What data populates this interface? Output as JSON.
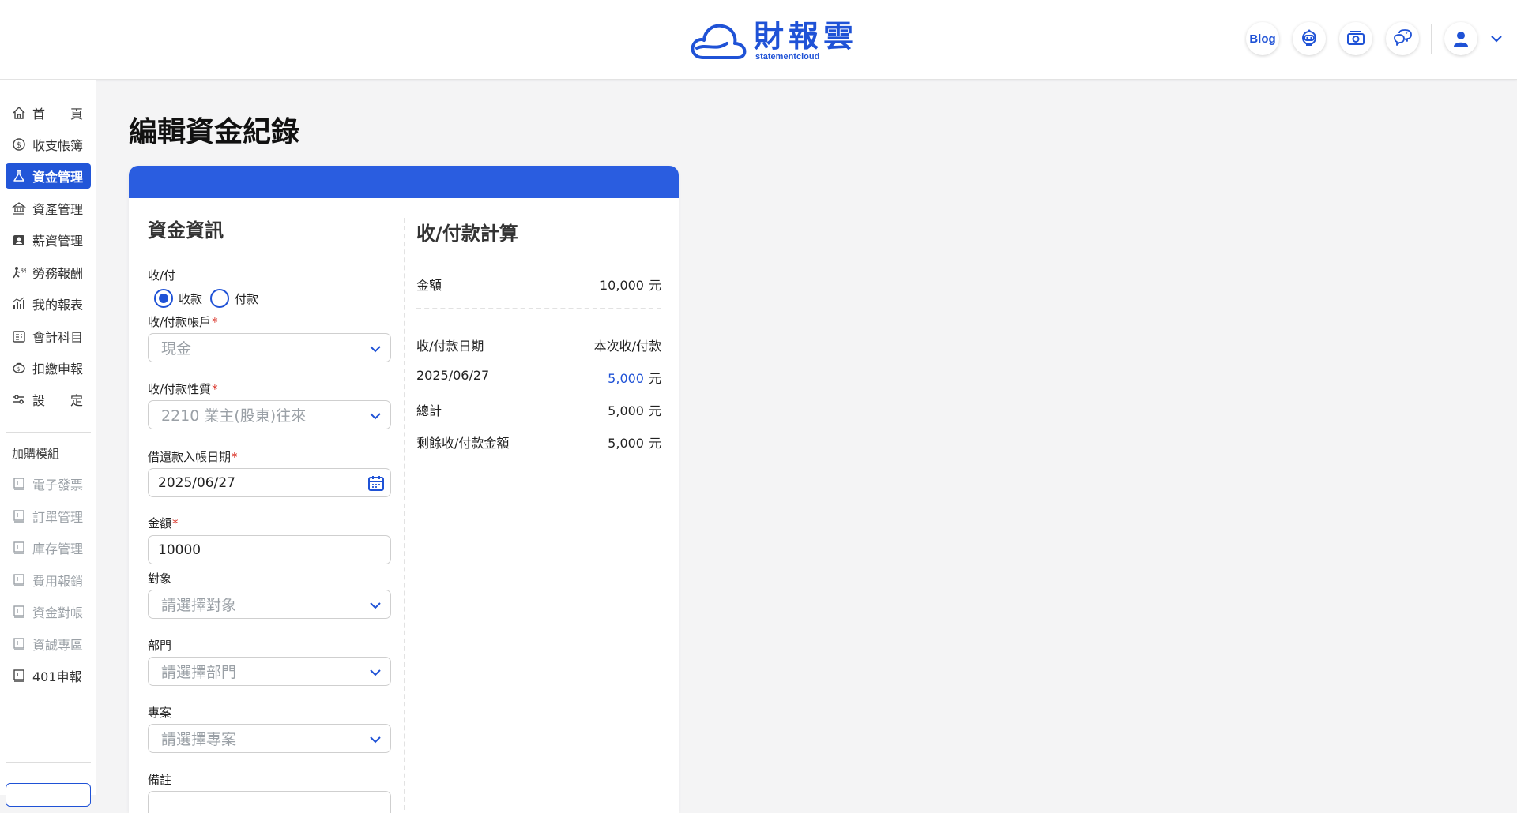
{
  "header": {
    "logo_title": "財報雲",
    "logo_sub": "statementcloud",
    "blog_label": "Blog",
    "icons": [
      "robot-icon",
      "cash-icon",
      "chat-help-icon",
      "user-avatar-icon",
      "chevron-down-icon"
    ]
  },
  "sidebar": {
    "items": [
      {
        "label_a": "首",
        "label_b": "頁",
        "icon": "home-icon"
      },
      {
        "label": "收支帳簿",
        "icon": "coin-icon"
      },
      {
        "label": "資金管理",
        "icon": "flask-icon",
        "active": true
      },
      {
        "label": "資產管理",
        "icon": "asset-icon"
      },
      {
        "label": "薪資管理",
        "icon": "salary-icon"
      },
      {
        "label": "勞務報酬",
        "icon": "labor-icon"
      },
      {
        "label": "我的報表",
        "icon": "report-icon"
      },
      {
        "label": "會計科目",
        "icon": "ledger-icon"
      },
      {
        "label": "扣繳申報",
        "icon": "tax-icon"
      },
      {
        "label_a": "設",
        "label_b": "定",
        "icon": "settings-icon"
      }
    ],
    "addon_group": "加購模組",
    "addons": [
      {
        "label": "電子發票",
        "disabled": true
      },
      {
        "label": "訂單管理",
        "disabled": true
      },
      {
        "label": "庫存管理",
        "disabled": true
      },
      {
        "label": "費用報銷",
        "disabled": true
      },
      {
        "label": "資金對帳",
        "disabled": true
      },
      {
        "label": "資誠專區",
        "disabled": true
      },
      {
        "label": "401申報",
        "disabled": false
      }
    ]
  },
  "page": {
    "title": "編輯資金紀錄"
  },
  "form": {
    "section_title": "資金資訊",
    "type_label": "收/付",
    "type_options": [
      "收款",
      "付款"
    ],
    "type_selected": "收款",
    "account_label": "收/付款帳戶",
    "account_value": "現金",
    "nature_label": "收/付款性質",
    "nature_value": "2210 業主(股東)往來",
    "date_label": "借還款入帳日期",
    "date_value": "2025/06/27",
    "amount_label": "金額",
    "amount_value": "10000",
    "target_label": "對象",
    "target_placeholder": "請選擇對象",
    "dept_label": "部門",
    "dept_placeholder": "請選擇部門",
    "project_label": "專案",
    "project_placeholder": "請選擇專案",
    "note_label": "備註"
  },
  "calc": {
    "section_title": "收/付款計算",
    "amount_label": "金額",
    "amount_value": "10,000",
    "unit": "元",
    "date_col": "收/付款日期",
    "this_col": "本次收/付款",
    "row_date": "2025/06/27",
    "row_value": "5,000",
    "total_label": "總計",
    "total_value": "5,000",
    "remain_label": "剩餘收/付款金額",
    "remain_value": "5,000"
  },
  "colors": {
    "accent": "#1f52d6",
    "header_band": "#2a5de0",
    "required": "#d93025"
  }
}
